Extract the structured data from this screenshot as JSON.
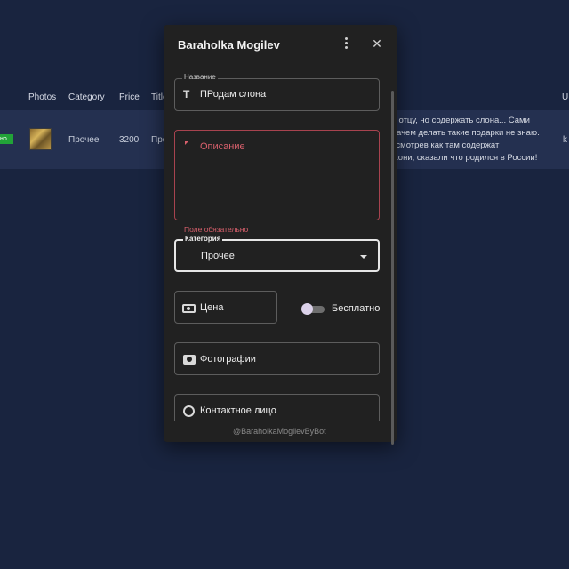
{
  "table": {
    "headers": {
      "photos": "Photos",
      "category": "Category",
      "price": "Price",
      "title": "Title",
      "last": "U"
    },
    "row": {
      "status": "но",
      "category": "Прочее",
      "price": "3200",
      "title": "Про",
      "last": "k",
      "description_lines": [
        "ли отцу, но содержать слона... Сами",
        ". Зачем делать такие подарки не знаю.",
        "посмотрев как там содержат",
        "Джони, сказали что родился в России!"
      ]
    }
  },
  "dialog": {
    "title": "Baraholka Mogilev",
    "name_field": {
      "legend": "Название",
      "value": "ПРодам слона"
    },
    "description_field": {
      "placeholder": "Описание",
      "error": "Поле обязательно"
    },
    "category_field": {
      "legend": "Категория",
      "value": "Прочее"
    },
    "price_field": {
      "label": "Цена"
    },
    "free_toggle": {
      "label": "Бесплатно",
      "on": false
    },
    "photos_field": {
      "label": "Фотографии"
    },
    "contact_field": {
      "label": "Контактное лицо"
    },
    "footer": "@BaraholkaMogilevByBot"
  },
  "icons": {
    "name": "text-t-icon",
    "description": "chat-bubble-icon",
    "category": "list-icon",
    "price": "money-icon",
    "photos": "camera-icon",
    "contact": "person-circle-icon"
  },
  "colors": {
    "page_bg": "#19243f",
    "row_bg": "#243050",
    "dialog_bg": "#212121",
    "error": "#d8606c",
    "status_badge": "#22a338"
  }
}
